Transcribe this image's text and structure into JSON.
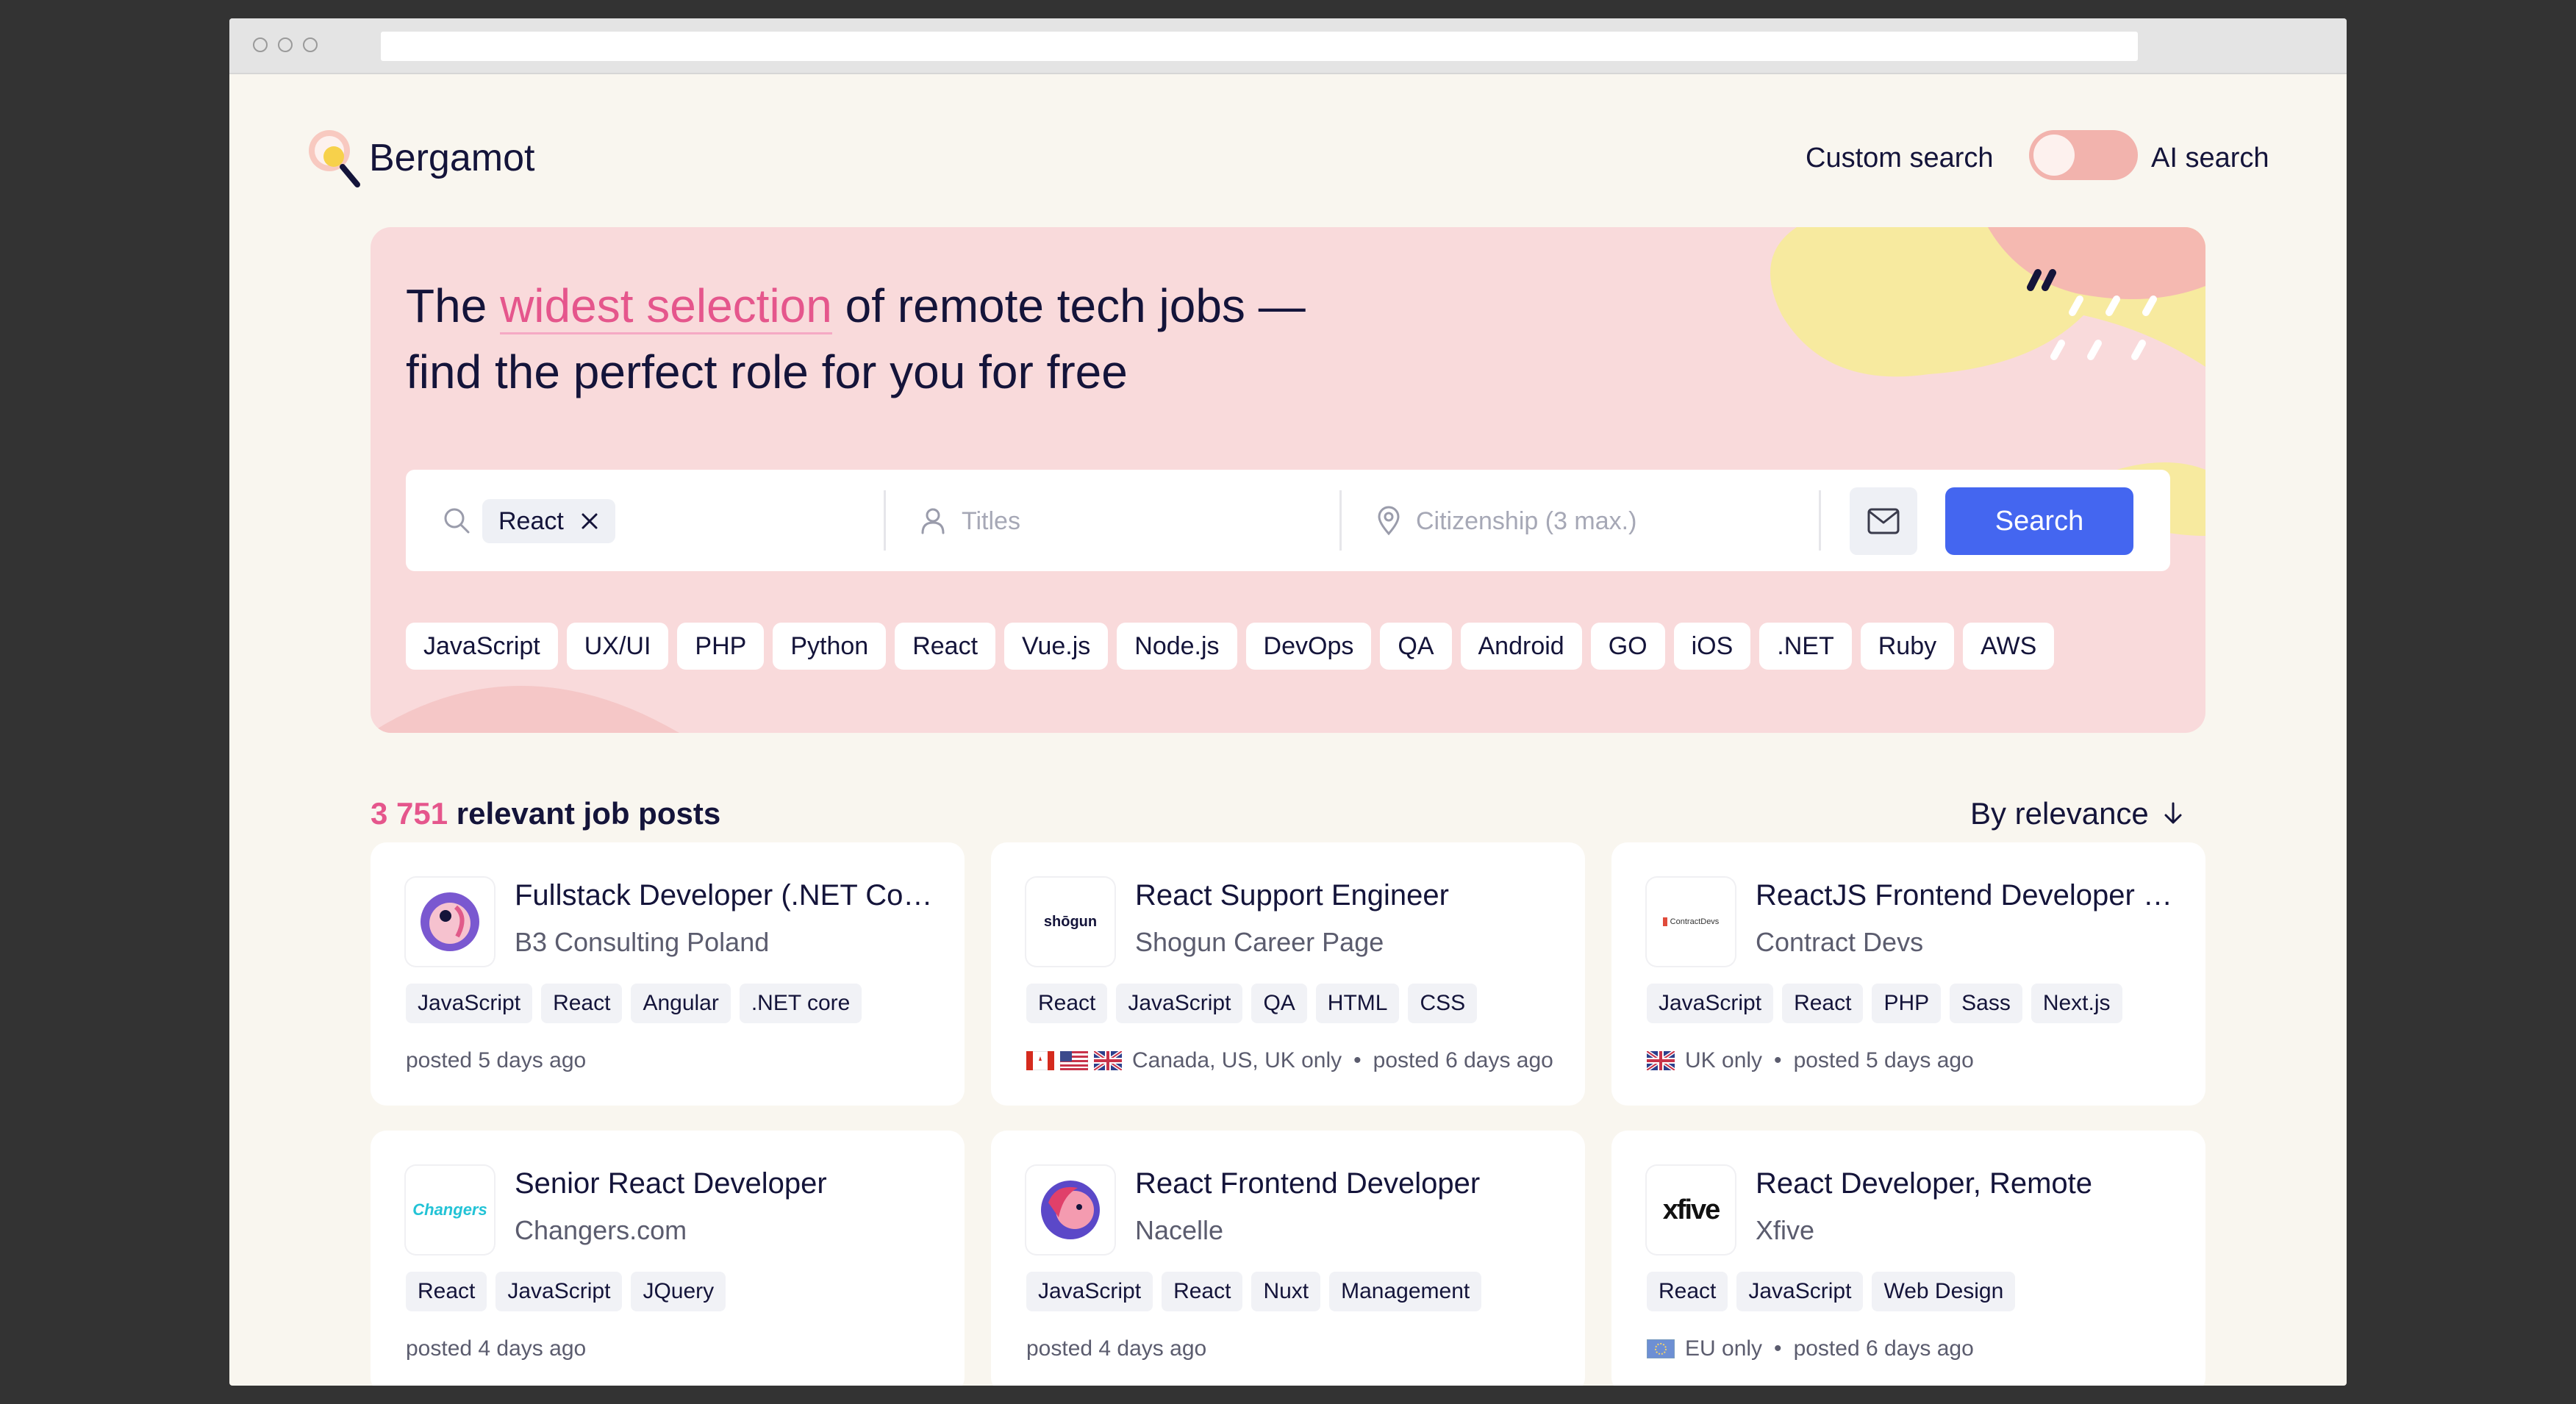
{
  "header": {
    "brand": "Bergamot",
    "mode_left": "Custom search",
    "mode_right": "AI search"
  },
  "hero": {
    "headline_pre": "The ",
    "headline_highlight": "widest selection",
    "headline_post": " of remote tech jobs —",
    "headline_line2": "find the perfect role for you for free",
    "search": {
      "keyword_chip": "React",
      "titles_placeholder": "Titles",
      "citizenship_placeholder": "Citizenship (3 max.)",
      "search_label": "Search"
    },
    "tags": [
      "JavaScript",
      "UX/UI",
      "PHP",
      "Python",
      "React",
      "Vue.js",
      "Node.js",
      "DevOps",
      "QA",
      "Android",
      "GO",
      "iOS",
      ".NET",
      "Ruby",
      "AWS"
    ]
  },
  "results": {
    "count": "3 751",
    "count_label": " relevant job posts",
    "sort_label": "By relevance"
  },
  "jobs": [
    {
      "title": "Fullstack Developer (.NET Core...",
      "company": "B3 Consulting Poland",
      "tags": [
        "JavaScript",
        "React",
        "Angular",
        ".NET core"
      ],
      "location": "",
      "posted": "posted 5 days ago",
      "logo": "b3-consulting-logo"
    },
    {
      "title": "React Support Engineer",
      "company": "Shogun Career Page",
      "tags": [
        "React",
        "JavaScript",
        "QA",
        "HTML",
        "CSS"
      ],
      "location": "Canada, US, UK only",
      "posted": "posted 6 days ago",
      "logo": "shogun-logo",
      "logo_text": "shōgun"
    },
    {
      "title": "ReactJS Frontend Developer R...",
      "company": "Contract Devs",
      "tags": [
        "JavaScript",
        "React",
        "PHP",
        "Sass",
        "Next.js"
      ],
      "location": "UK only",
      "posted": "posted 5 days ago",
      "logo": "contract-devs-logo",
      "logo_text": "ContractDevs"
    },
    {
      "title": "Senior React Developer",
      "company": "Changers.com",
      "tags": [
        "React",
        "JavaScript",
        "JQuery"
      ],
      "location": "",
      "posted": "posted 4 days ago",
      "logo": "changers-logo",
      "logo_text": "Changers"
    },
    {
      "title": "React Frontend Developer",
      "company": "Nacelle",
      "tags": [
        "JavaScript",
        "React",
        "Nuxt",
        "Management"
      ],
      "location": "",
      "posted": "posted 4 days ago",
      "logo": "nacelle-logo"
    },
    {
      "title": "React Developer, Remote",
      "company": "Xfive",
      "tags": [
        "React",
        "JavaScript",
        "Web Design"
      ],
      "location": "EU only",
      "posted": "posted 6 days ago",
      "logo": "xfive-logo",
      "logo_text": "xfive"
    }
  ],
  "colors": {
    "accent": "#e5568c",
    "primary_button": "#4466f0",
    "hero_bg": "#f9dadb",
    "toggle": "#f2b3ad"
  }
}
